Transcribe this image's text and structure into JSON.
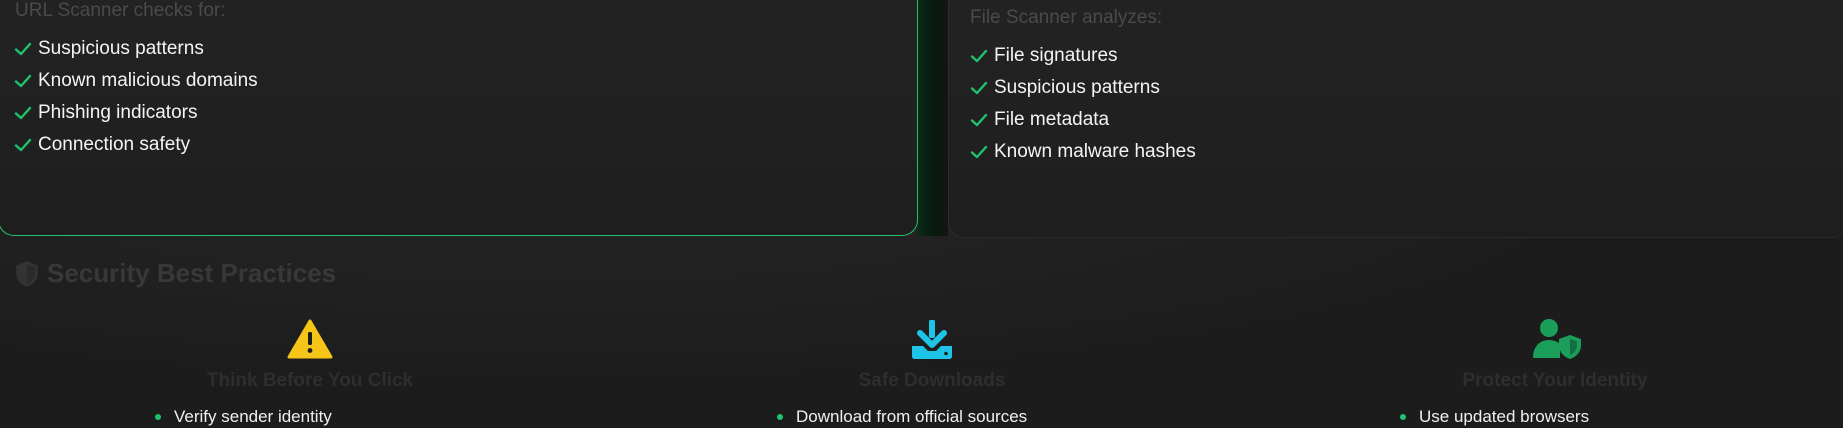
{
  "url_scanner": {
    "heading": "URL Scanner checks for:",
    "items": [
      "Suspicious patterns",
      "Known malicious domains",
      "Phishing indicators",
      "Connection safety"
    ]
  },
  "file_scanner": {
    "heading": "File Scanner analyzes:",
    "items": [
      "File signatures",
      "Suspicious patterns",
      "File metadata",
      "Known malware hashes"
    ]
  },
  "best_practices": {
    "title": "Security Best Practices",
    "cards": [
      {
        "icon": "warning-icon",
        "color": "#f5c518",
        "title": "Think Before You Click",
        "items": [
          "Verify sender identity"
        ]
      },
      {
        "icon": "download-icon",
        "color": "#1ec3e8",
        "title": "Safe Downloads",
        "items": [
          "Download from official sources"
        ]
      },
      {
        "icon": "user-shield-icon",
        "color": "#1a9e5a",
        "title": "Protect Your Identity",
        "items": [
          "Use updated browsers"
        ]
      }
    ]
  },
  "colors": {
    "accent": "#1ec46b",
    "check": "#1ec46b",
    "background": "#1c1c1c"
  }
}
